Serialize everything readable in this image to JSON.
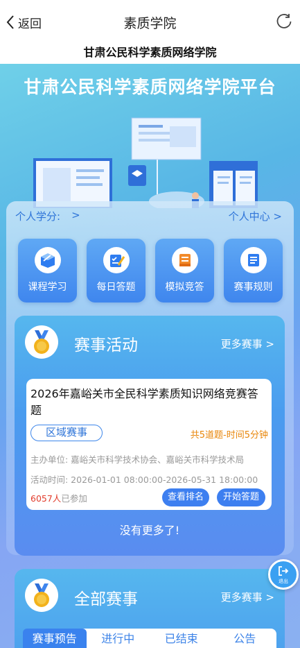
{
  "nav": {
    "back_label": "返回",
    "title": "素质学院"
  },
  "subtitle": "甘肃公民科学素质网络学院",
  "banner": {
    "title": "甘肃公民科学素质网络学院平台"
  },
  "panel": {
    "credit_label": "个人学分:",
    "credit_arrow": ">",
    "center_label": "个人中心 >",
    "tiles": [
      {
        "label": "课程学习",
        "icon": "course-icon"
      },
      {
        "label": "每日答题",
        "icon": "quiz-icon"
      },
      {
        "label": "模拟竞答",
        "icon": "mock-icon"
      },
      {
        "label": "赛事规则",
        "icon": "rules-icon"
      }
    ]
  },
  "events": {
    "title": "赛事活动",
    "more": "更多赛事 >",
    "card": {
      "title": "2026年嘉峪关市全民科学素质知识网络竞赛答题",
      "tag": "区域赛事",
      "meta": "共5道题-时间5分钟",
      "organizer": "主办单位: 嘉峪关市科学技术协会、嘉峪关市科学技术局",
      "time": "活动时间: 2026-01-01 08:00:00-2026-05-31 18:00:00",
      "count_num": "6057人",
      "count_suffix": "已参加",
      "rank_button": "查看排名",
      "start_button": "开始答题"
    },
    "no_more": "没有更多了!"
  },
  "exit": {
    "label": "退出"
  },
  "all_events": {
    "title": "全部赛事",
    "more": "更多赛事 >",
    "tabs": [
      "赛事预告",
      "进行中",
      "已结束",
      "公告"
    ]
  },
  "colors": {
    "accent": "#3d7ff0",
    "orange": "#e8860a",
    "red": "#e23c2c",
    "gold": "#f2b21c"
  }
}
